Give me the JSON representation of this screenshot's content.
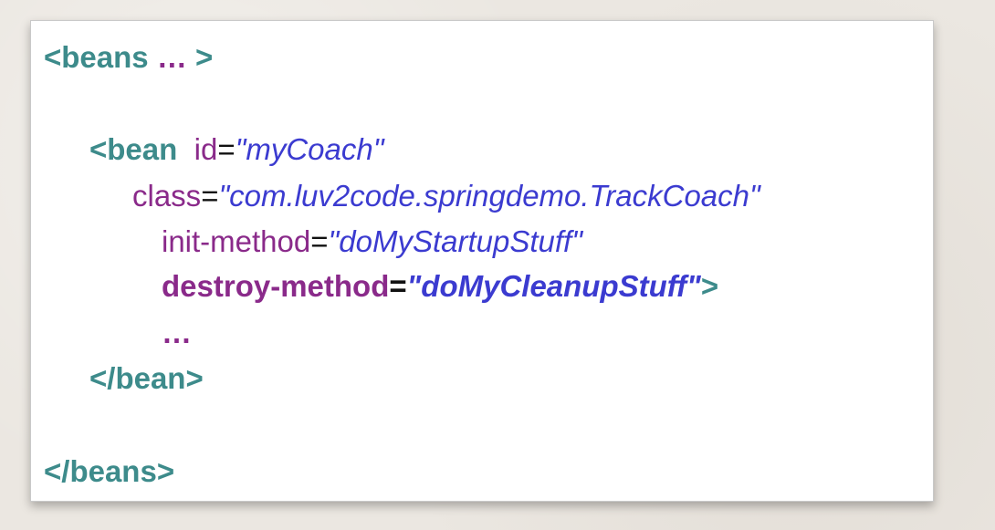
{
  "code": {
    "line1": {
      "open": "<beans",
      "dots": " … ",
      "close": ">"
    },
    "line2": {
      "tag": "<bean",
      "attr": "id",
      "eq": "=",
      "value": "\"myCoach\""
    },
    "line3": {
      "attr": "class",
      "eq": "=",
      "value": "\"com.luv2code.springdemo.TrackCoach\""
    },
    "line4": {
      "attr": "init-method",
      "eq": "=",
      "value": "\"doMyStartupStuff\""
    },
    "line5": {
      "attr": "destroy-method",
      "eq": "=",
      "value": "\"doMyCleanupStuff\"",
      "close": ">"
    },
    "line6": {
      "dots": "…"
    },
    "line7": {
      "tag": "</bean>"
    },
    "line8": {
      "tag": "</beans>"
    }
  },
  "colors": {
    "tag": "#3d8b8b",
    "attribute": "#8a2a8a",
    "value": "#3b3bd0",
    "background": "#ebe7e1"
  }
}
